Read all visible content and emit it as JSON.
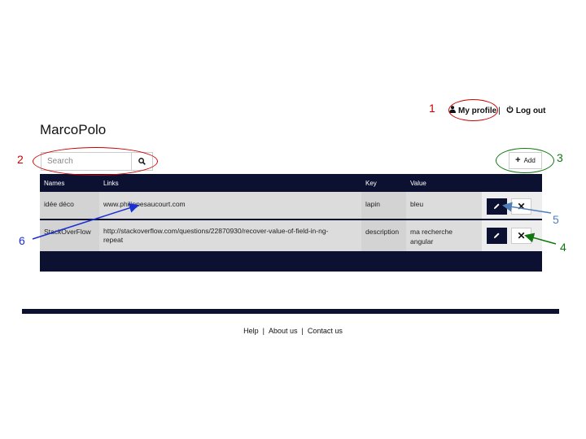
{
  "header": {
    "app_title": "MarcoPolo",
    "my_profile": "My profile",
    "separator": "|",
    "logout": "Log out"
  },
  "search": {
    "placeholder": "Search"
  },
  "toolbar": {
    "add_label": "Add"
  },
  "table": {
    "columns": [
      "Names",
      "Links",
      "Key",
      "Value"
    ],
    "rows": [
      {
        "name": "idée déco",
        "links": [
          "www.philippesaucourt.com"
        ],
        "key": "lapin",
        "value": [
          "bleu"
        ]
      },
      {
        "name": "StackOverFlow",
        "links": [
          "http://stackoverflow.com/questions/22870930/recover-value-of-field-in-ng-",
          "repeat"
        ],
        "key": "description",
        "value": [
          "ma recherche",
          "angular"
        ]
      }
    ]
  },
  "footer": {
    "help": "Help",
    "about": "About us",
    "contact": "Contact us",
    "separator": "|"
  },
  "annotations": {
    "n1": "1",
    "n2": "2",
    "n3": "3",
    "n4": "4",
    "n5": "5",
    "n6": "6",
    "colors": {
      "red": "#cc0000",
      "green": "#117711",
      "blue": "#1a2fd4",
      "steel": "#4f7fba"
    }
  },
  "colors": {
    "navy": "#0d1131",
    "row_bg": "#d3d3d3",
    "cell_bg": "#dcdcdc"
  },
  "icons": {
    "profile": "user-icon",
    "logout": "power-icon",
    "search": "search-icon",
    "add": "plus-icon",
    "edit": "pencil-icon",
    "delete": "close-icon"
  }
}
